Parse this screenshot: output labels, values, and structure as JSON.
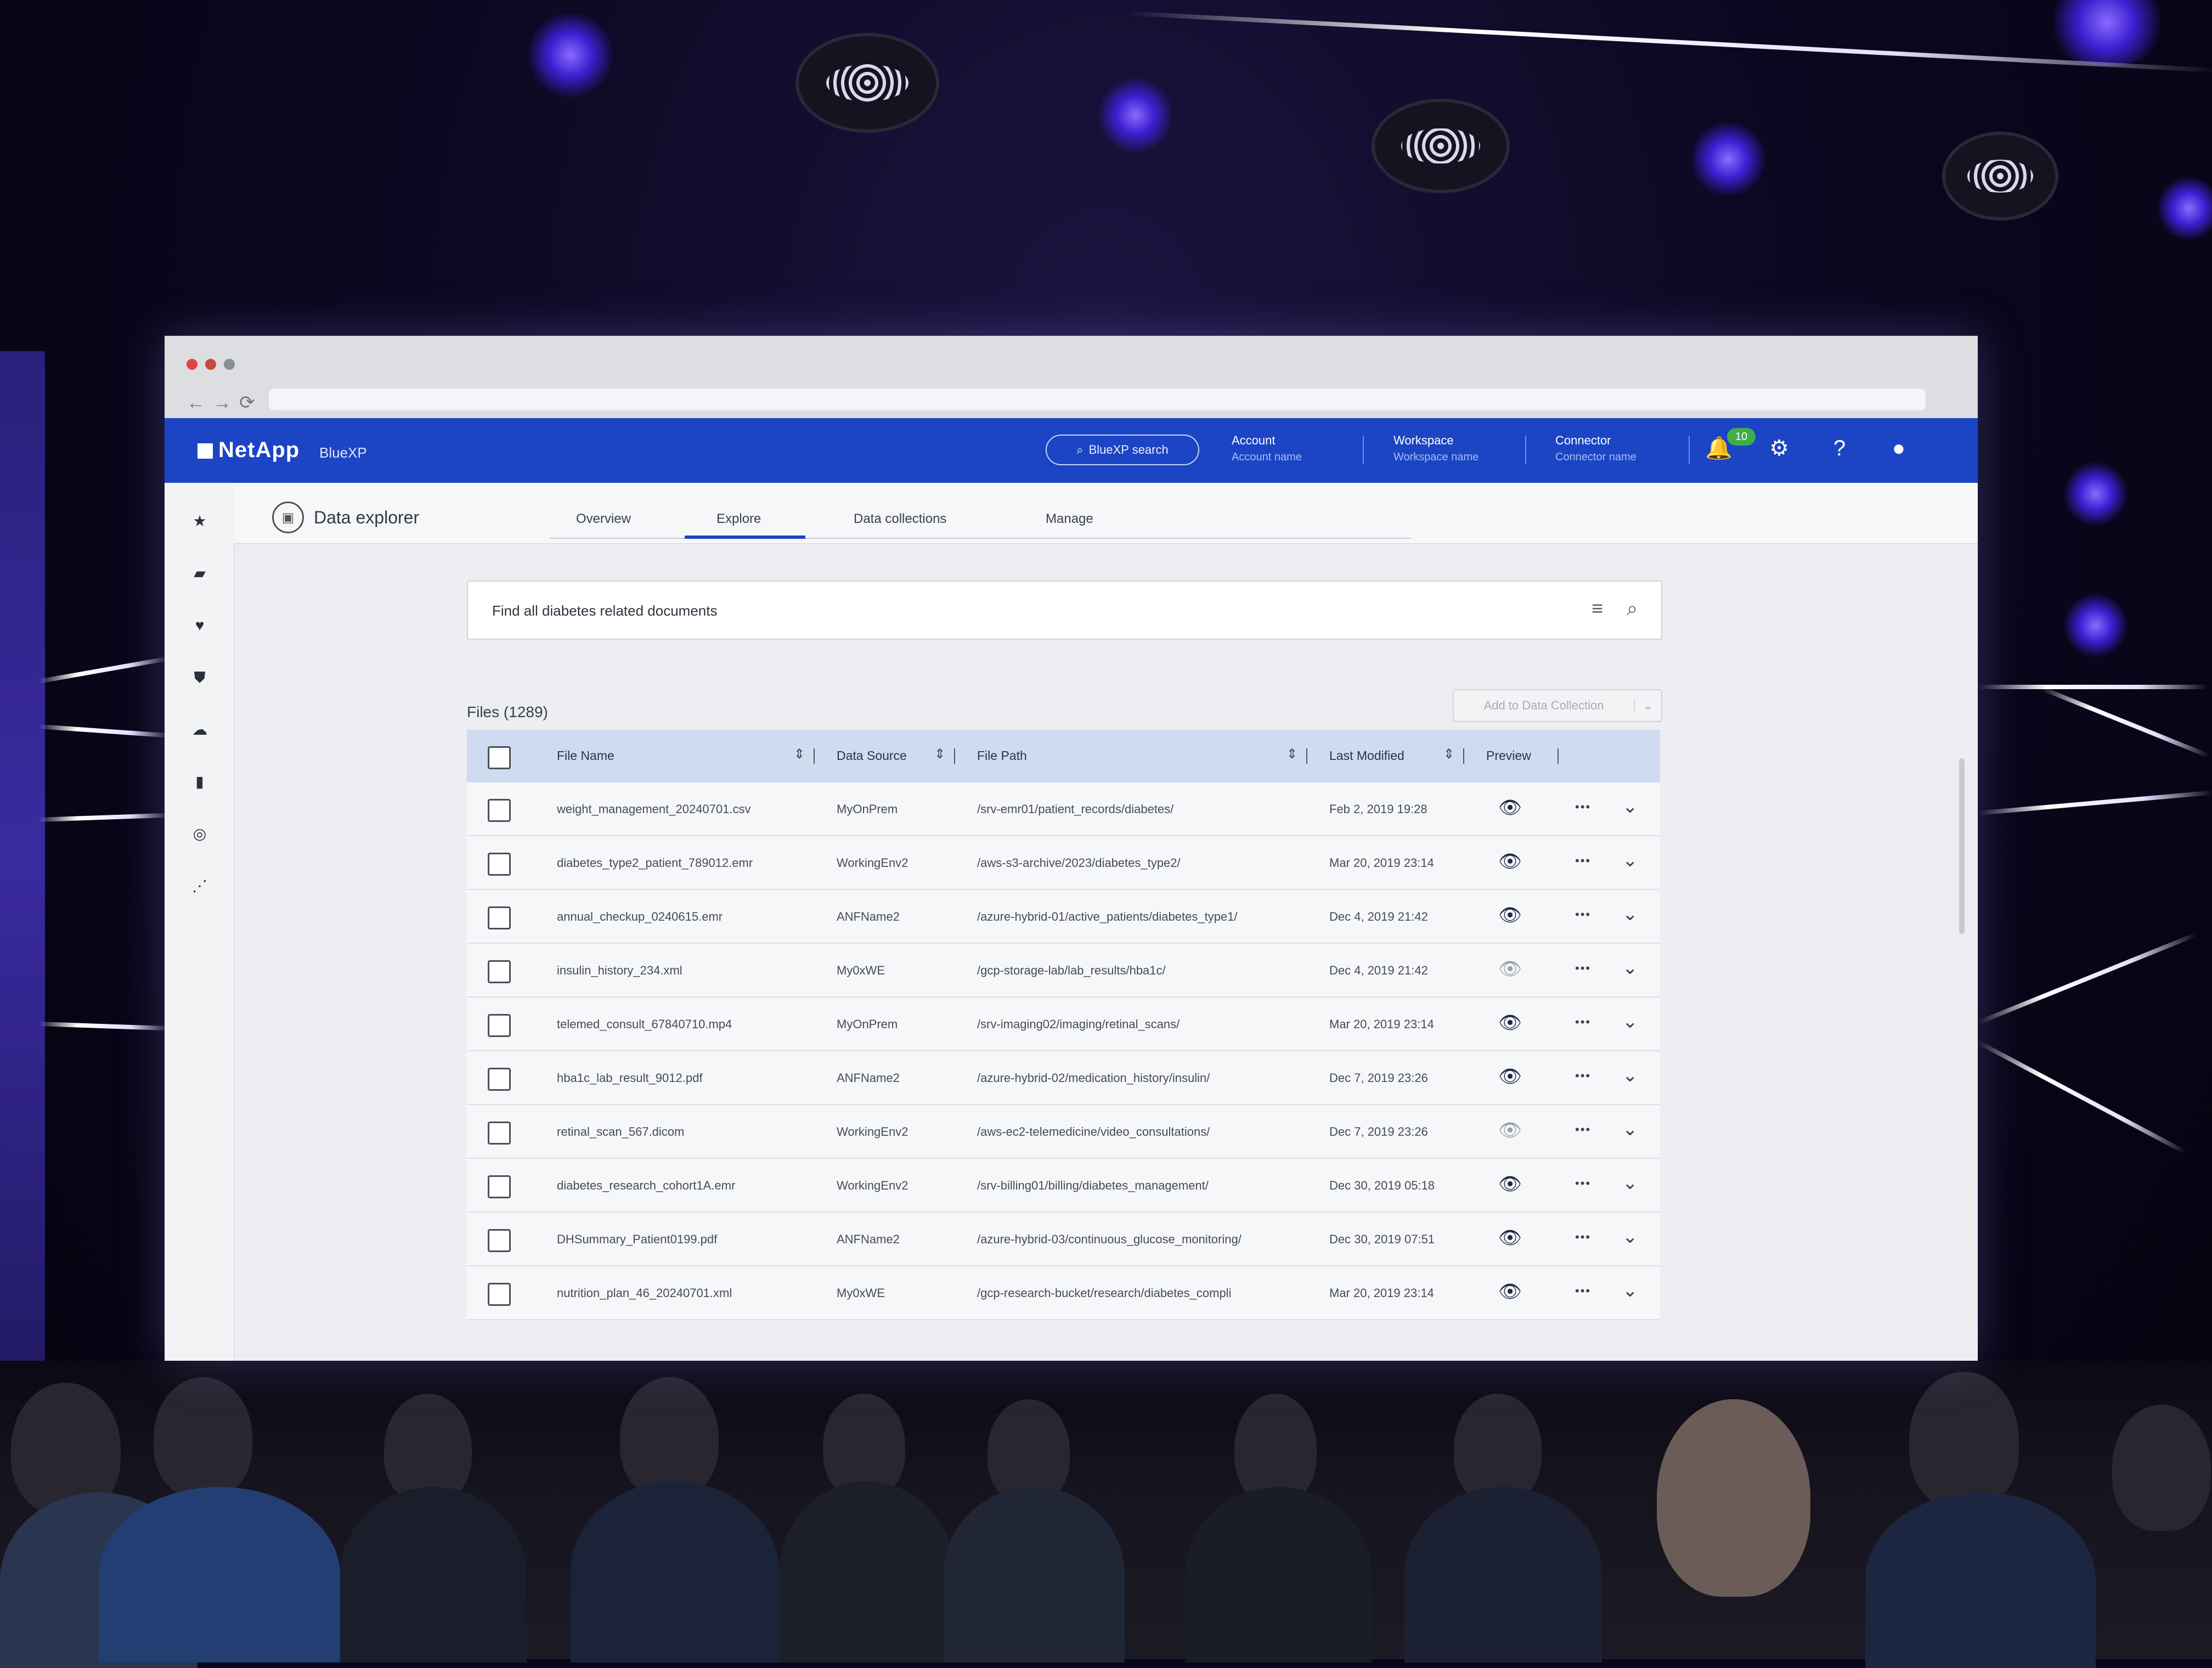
{
  "browser": {
    "nav_glyphs": "←→⟳"
  },
  "topbar": {
    "brand": "NetApp",
    "product": "BlueXP",
    "search_label": "BlueXP search",
    "account": {
      "label": "Account",
      "value": "Account name"
    },
    "workspace": {
      "label": "Workspace",
      "value": "Workspace name"
    },
    "connector": {
      "label": "Connector",
      "value": "Connector name"
    },
    "notifications_count": "10",
    "accent_color": "#1b45c4"
  },
  "app": {
    "title": "Data explorer",
    "tabs": [
      {
        "label": "Overview",
        "active": false
      },
      {
        "label": "Explore",
        "active": true
      },
      {
        "label": "Data collections",
        "active": false
      },
      {
        "label": "Manage",
        "active": false
      }
    ]
  },
  "leftnav": [
    "star-icon",
    "storage-icon",
    "heart-shield-icon",
    "shield-icon",
    "cloud-sync-icon",
    "bar-chart-icon",
    "target-icon",
    "share-nodes-icon"
  ],
  "search": {
    "query": "Find all diabetes related documents"
  },
  "files": {
    "count_label": "Files (1289)",
    "add_button": "Add to Data Collection",
    "columns": [
      "File Name",
      "Data Source",
      "File Path",
      "Last Modified",
      "Preview"
    ],
    "rows": [
      {
        "name": "weight_management_20240701.csv",
        "source": "MyOnPrem",
        "path": "/srv-emr01/patient_records/diabetes/",
        "modified": "Feb 2, 2019 19:28",
        "preview": true
      },
      {
        "name": "diabetes_type2_patient_789012.emr",
        "source": "WorkingEnv2",
        "path": "/aws-s3-archive/2023/diabetes_type2/",
        "modified": "Mar 20, 2019 23:14",
        "preview": true
      },
      {
        "name": "annual_checkup_0240615.emr",
        "source": "ANFName2",
        "path": "/azure-hybrid-01/active_patients/diabetes_type1/",
        "modified": "Dec 4, 2019 21:42",
        "preview": true
      },
      {
        "name": "insulin_history_234.xml",
        "source": "My0xWE",
        "path": "/gcp-storage-lab/lab_results/hba1c/",
        "modified": "Dec 4, 2019 21:42",
        "preview": false
      },
      {
        "name": "telemed_consult_67840710.mp4",
        "source": "MyOnPrem",
        "path": "/srv-imaging02/imaging/retinal_scans/",
        "modified": "Mar 20, 2019 23:14",
        "preview": true
      },
      {
        "name": "hba1c_lab_result_9012.pdf",
        "source": "ANFName2",
        "path": "/azure-hybrid-02/medication_history/insulin/",
        "modified": "Dec 7, 2019 23:26",
        "preview": true
      },
      {
        "name": "retinal_scan_567.dicom",
        "source": "WorkingEnv2",
        "path": "/aws-ec2-telemedicine/video_consultations/",
        "modified": "Dec 7, 2019 23:26",
        "preview": false
      },
      {
        "name": "diabetes_research_cohort1A.emr",
        "source": "WorkingEnv2",
        "path": "/srv-billing01/billing/diabetes_management/",
        "modified": "Dec 30, 2019 05:18",
        "preview": true
      },
      {
        "name": "DHSummary_Patient0199.pdf",
        "source": "ANFName2",
        "path": "/azure-hybrid-03/continuous_glucose_monitoring/",
        "modified": "Dec 30, 2019 07:51",
        "preview": true
      },
      {
        "name": "nutrition_plan_46_20240701.xml",
        "source": "My0xWE",
        "path": "/gcp-research-bucket/research/diabetes_compli",
        "modified": "Mar 20, 2019 23:14",
        "preview": true
      }
    ],
    "more_glyph": "•••",
    "chevron_glyph": "⌄"
  }
}
